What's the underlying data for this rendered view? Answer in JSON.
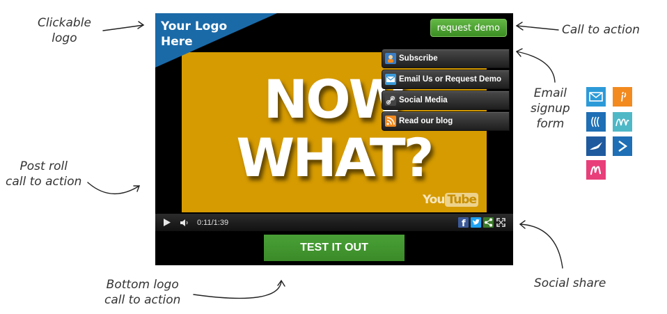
{
  "annotations": {
    "clickable_logo": "Clickable\nlogo",
    "call_to_action": "Call to action",
    "email_signup": "Email\nsignup\nform",
    "post_roll": "Post roll\ncall to action",
    "bottom_logo": "Bottom logo\ncall to action",
    "social_share": "Social share"
  },
  "player": {
    "logo_text": "Your Logo Here",
    "request_demo_label": "request demo",
    "headline_line1": "NOW",
    "headline_line2": "WHAT?",
    "youtube_you": "You",
    "youtube_tube": "Tube",
    "social_menu": [
      {
        "label": "Subscribe",
        "icon": "subscribe-icon"
      },
      {
        "label": "Email Us or Request Demo",
        "icon": "email-icon"
      },
      {
        "label": "Social Media",
        "icon": "link-icon"
      },
      {
        "label": "Read our blog",
        "icon": "rss-icon"
      }
    ],
    "controls": {
      "time": "0:11/1:39",
      "share_buttons": [
        "facebook-icon",
        "twitter-icon",
        "share-icon",
        "fullscreen-icon"
      ]
    },
    "cta_label": "TEST IT OUT"
  },
  "colors": {
    "video_bg": "#d69b00",
    "logo_corner": "#1a6aa8",
    "cta_green": "#43982f",
    "email_tile": "#2d9ad8",
    "orange_tile": "#f28a1f",
    "blue_tile": "#1e6fb5",
    "teal_tile": "#4fb8c7",
    "navy_tile": "#1f5a9e",
    "pink_tile": "#e83f7a"
  },
  "email_providers": [
    "email-provider-icon",
    "orange-provider-icon",
    "blue-waves-provider-icon",
    "teal-m-provider-icon",
    "navy-bird-provider-icon",
    "blue-arrow-provider-icon",
    "pink-m-provider-icon"
  ]
}
